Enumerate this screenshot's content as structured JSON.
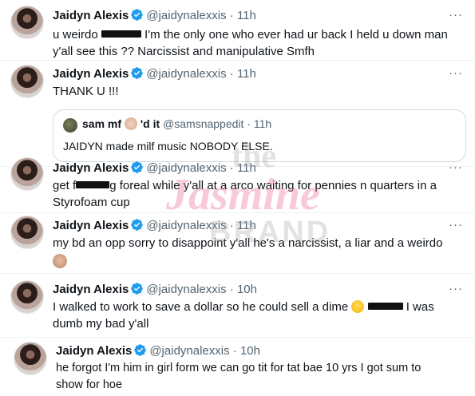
{
  "tweets": [
    {
      "name": "Jaidyn Alexis",
      "handle": "@jaidynalexxis",
      "dot": "·",
      "time": "11h",
      "more": "···",
      "lines": [
        "u weirdo",
        "I'm the only one who ever had ur back I held u down man",
        "y'all see this ?? Narcissist and manipulative Smfh"
      ]
    },
    {
      "name": "Jaidyn Alexis",
      "handle": "@jaidynalexxis",
      "dot": "·",
      "time": "11h",
      "more": "···",
      "text": "THANK U !!!",
      "quote": {
        "name": "sam mf",
        "name_suffix": "'d it",
        "handle": "@samsnappedit",
        "dot": "·",
        "time": "11h",
        "text": "JAIDYN made milf music NOBODY ELSE."
      }
    },
    {
      "name": "Jaidyn Alexis",
      "handle": "@jaidynalexxis",
      "dot": "·",
      "time": "11h",
      "more": "···",
      "line1_a": "get f",
      "line1_b": "g foreal while y'all at a arco waiting for pennies n quarters in a",
      "line2": "Styrofoam cup"
    },
    {
      "name": "Jaidyn Alexis",
      "handle": "@jaidynalexxis",
      "dot": "·",
      "time": "11h",
      "more": "···",
      "text": "my bd an opp sorry to disappoint y'all he's a narcissist, a liar and a weirdo"
    },
    {
      "name": "Jaidyn Alexis",
      "handle": "@jaidynalexxis",
      "dot": "·",
      "time": "10h",
      "more": "···",
      "line1_a": "I walked to work to save a dollar so he could sell a dime",
      "line1_b": "I was",
      "line2": "dumb my bad y'all"
    },
    {
      "name": "Jaidyn Alexis",
      "handle": "@jaidynalexxis",
      "dot": "·",
      "time": "10h",
      "line1": "he forgot I'm him in girl form we can go tit for tat bae 10 yrs I got sum to",
      "line2": "show for hoe"
    }
  ],
  "watermark": {
    "the": "the",
    "jasmine": "Jasmine",
    "brand": "BRAND"
  },
  "colors": {
    "verified": "#1d9bf0",
    "text": "#0f1419",
    "secondary": "#536471",
    "border": "#cfd9de"
  }
}
